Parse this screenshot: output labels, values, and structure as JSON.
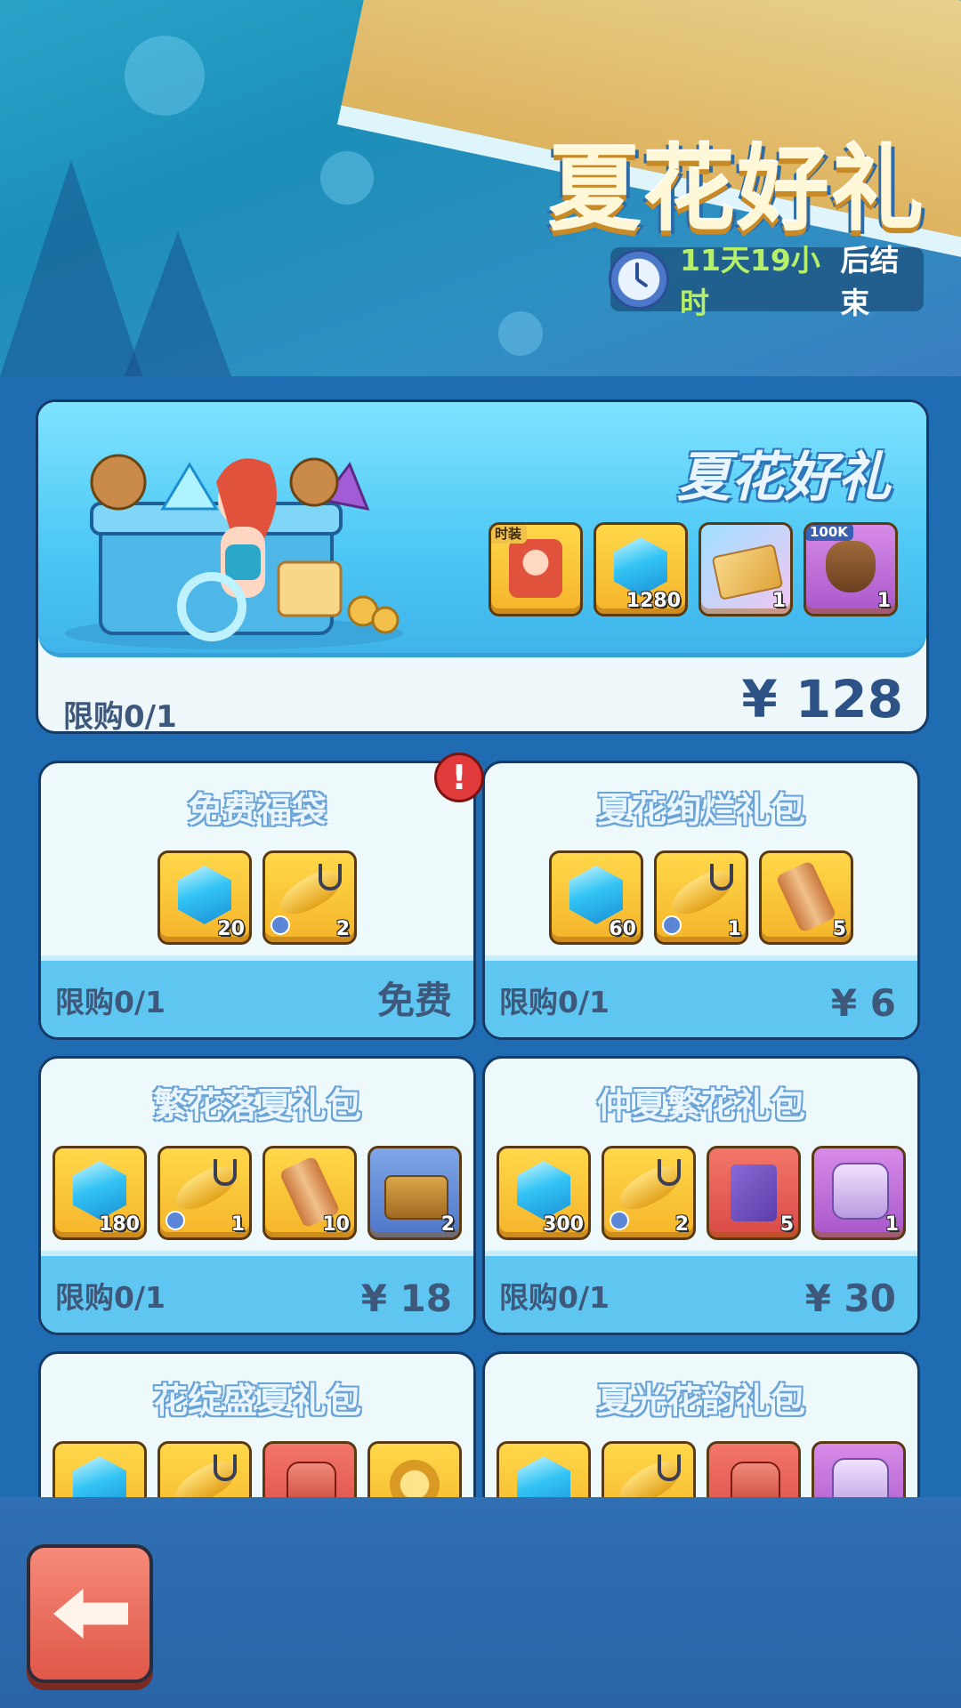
{
  "banner": {
    "title": "夏花好礼",
    "timer_remaining": "11天19小时",
    "timer_suffix": "后结束"
  },
  "featured": {
    "title": "夏花好礼",
    "items": [
      {
        "icon": "portrait-icon",
        "tag": "时装",
        "qty": ""
      },
      {
        "icon": "gem-icon",
        "tag": "",
        "qty": "1280"
      },
      {
        "icon": "ticket-icon",
        "tag": "",
        "qty": "1"
      },
      {
        "icon": "coin-bag-icon",
        "tag": "100K",
        "qty": "1"
      }
    ],
    "limit": "限购0/1",
    "price": "¥ 128"
  },
  "cards": [
    {
      "title": "免费福袋",
      "items": [
        {
          "icon": "gem-icon",
          "qty": "20"
        },
        {
          "icon": "golden-fish-icon",
          "qty": "2"
        }
      ],
      "limit": "限购0/1",
      "price": "免费"
    },
    {
      "title": "夏花绚烂礼包",
      "items": [
        {
          "icon": "gem-icon",
          "qty": "60"
        },
        {
          "icon": "golden-fish-icon",
          "qty": "1"
        },
        {
          "icon": "scroll-icon",
          "qty": "5"
        }
      ],
      "limit": "限购0/1",
      "price": "¥ 6"
    },
    {
      "title": "繁花落夏礼包",
      "items": [
        {
          "icon": "gem-icon",
          "qty": "180"
        },
        {
          "icon": "golden-fish-icon",
          "qty": "1"
        },
        {
          "icon": "scroll-icon",
          "qty": "10"
        },
        {
          "icon": "treasure-chest-icon",
          "qty": "2"
        }
      ],
      "limit": "限购0/1",
      "price": "¥ 18"
    },
    {
      "title": "仲夏繁花礼包",
      "items": [
        {
          "icon": "gem-icon",
          "qty": "300"
        },
        {
          "icon": "golden-fish-icon",
          "qty": "2"
        },
        {
          "icon": "spell-book-icon",
          "qty": "5"
        },
        {
          "icon": "mask-icon",
          "qty": "1"
        }
      ],
      "limit": "限购0/1",
      "price": "¥ 30"
    },
    {
      "title": "花绽盛夏礼包",
      "items": [
        {
          "icon": "gem-icon",
          "qty": ""
        },
        {
          "icon": "golden-fish-icon",
          "qty": ""
        },
        {
          "icon": "potion-icon",
          "qty": ""
        },
        {
          "icon": "coin-icon",
          "qty": ""
        }
      ],
      "limit": "",
      "price": ""
    },
    {
      "title": "夏光花韵礼包",
      "items": [
        {
          "icon": "gem-icon",
          "qty": ""
        },
        {
          "icon": "golden-fish-icon",
          "qty": ""
        },
        {
          "icon": "potion-icon",
          "qty": ""
        },
        {
          "icon": "mask-icon",
          "qty": ""
        }
      ],
      "limit": "",
      "price": ""
    }
  ],
  "alert": "!"
}
